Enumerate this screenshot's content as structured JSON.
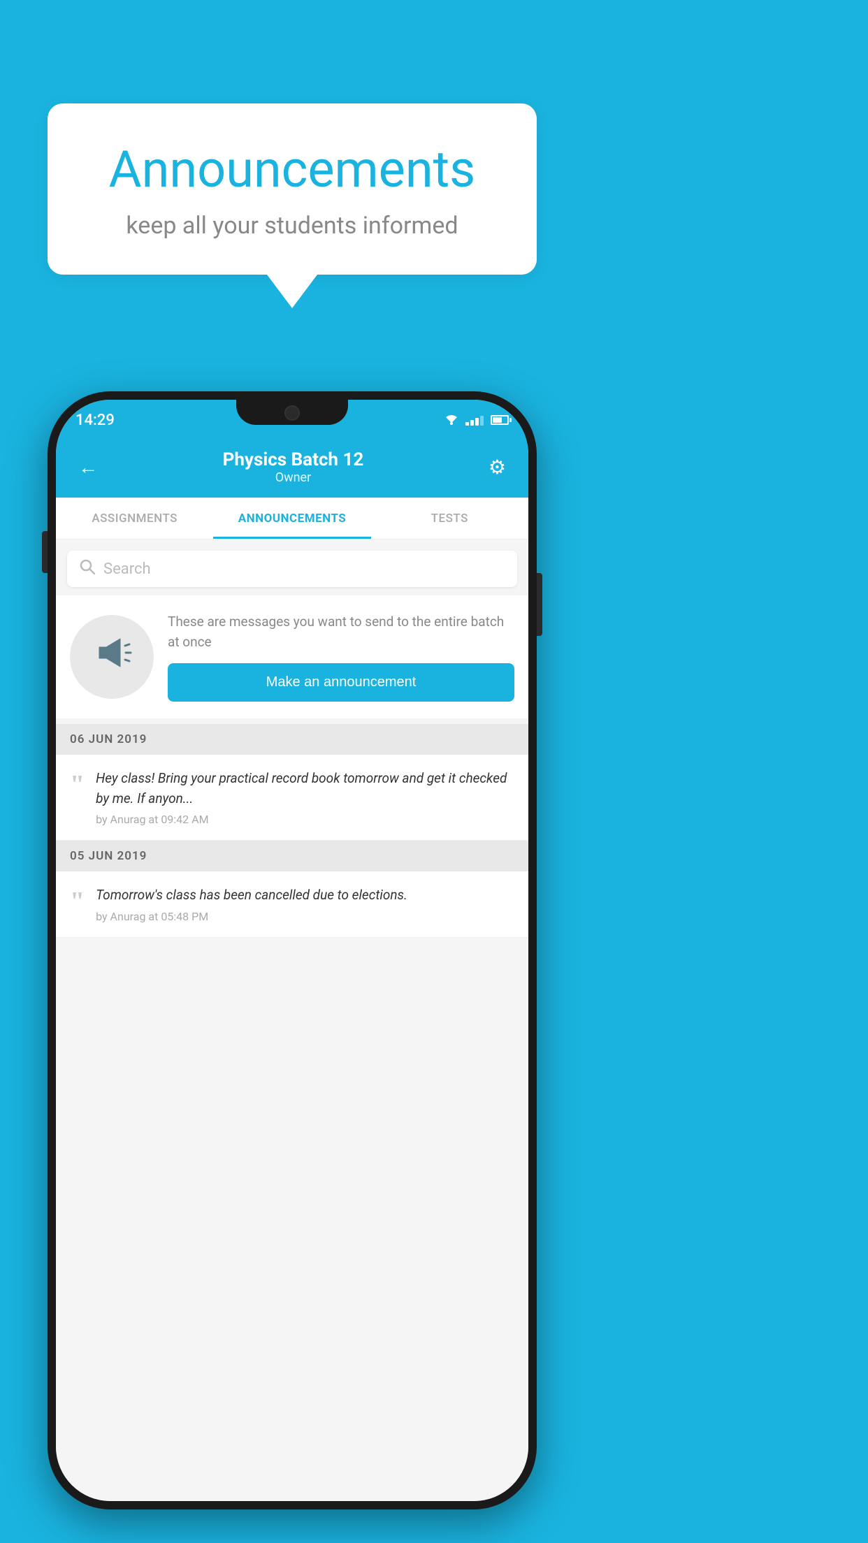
{
  "background_color": "#1ab3e0",
  "speech_bubble": {
    "title": "Announcements",
    "subtitle": "keep all your students informed"
  },
  "phone": {
    "status_bar": {
      "time": "14:29"
    },
    "header": {
      "title": "Physics Batch 12",
      "subtitle": "Owner",
      "back_label": "←",
      "gear_label": "⚙"
    },
    "tabs": [
      {
        "label": "ASSIGNMENTS",
        "active": false
      },
      {
        "label": "ANNOUNCEMENTS",
        "active": true
      },
      {
        "label": "TESTS",
        "active": false
      }
    ],
    "search": {
      "placeholder": "Search"
    },
    "announcement_prompt": {
      "description": "These are messages you want to send to the entire batch at once",
      "button_label": "Make an announcement"
    },
    "announcements": [
      {
        "date": "06  JUN  2019",
        "items": [
          {
            "text": "Hey class! Bring your practical record book tomorrow and get it checked by me. If anyon...",
            "meta": "by Anurag at 09:42 AM"
          }
        ]
      },
      {
        "date": "05  JUN  2019",
        "items": [
          {
            "text": "Tomorrow's class has been cancelled due to elections.",
            "meta": "by Anurag at 05:48 PM"
          }
        ]
      }
    ]
  }
}
